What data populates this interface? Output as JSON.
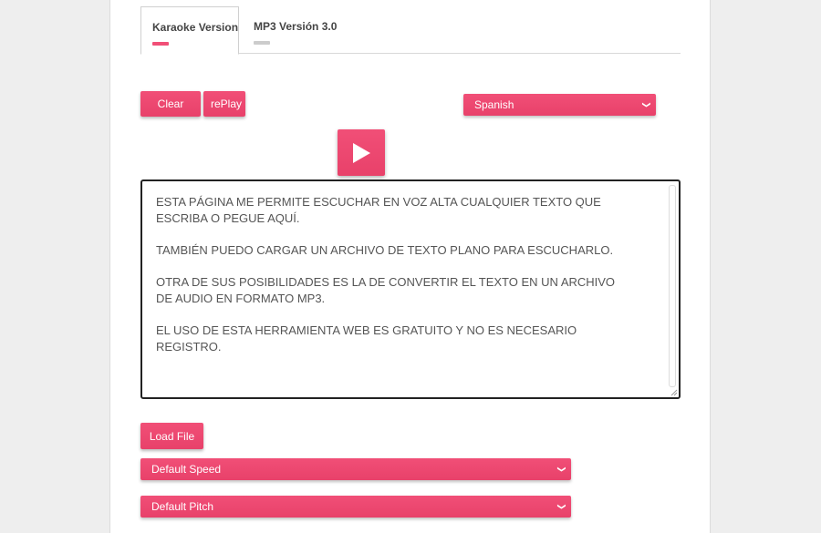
{
  "colors": {
    "accent": "#f14f77",
    "accent_dark": "#e8416a",
    "tab_inactive_bar": "#cccccc"
  },
  "tabs": [
    {
      "label": "Karaoke Version",
      "active": true
    },
    {
      "label": "MP3 Versión 3.0",
      "active": false
    }
  ],
  "toolbar": {
    "clear_label": "Clear Text",
    "replay_label": "rePlay"
  },
  "language_select": {
    "selected": "Spanish"
  },
  "play_button": {
    "icon": "play-icon"
  },
  "text_area": {
    "paragraphs": [
      "ESTA PÁGINA ME PERMITE ESCUCHAR EN VOZ ALTA CUALQUIER TEXTO QUE ESCRIBA O PEGUE AQUÍ.",
      "TAMBIÉN PUEDO CARGAR UN ARCHIVO DE TEXTO PLANO PARA ESCUCHARLO.",
      "OTRA DE SUS POSIBILIDADES ES LA DE CONVERTIR EL TEXTO EN UN ARCHIVO DE AUDIO EN FORMATO MP3.",
      "EL USO DE ESTA HERRAMIENTA WEB ES GRATUITO Y NO ES NECESARIO REGISTRO."
    ]
  },
  "load_file": {
    "label": "Load File"
  },
  "speed_select": {
    "selected": "Default Speed"
  },
  "pitch_select": {
    "selected": "Default Pitch"
  }
}
